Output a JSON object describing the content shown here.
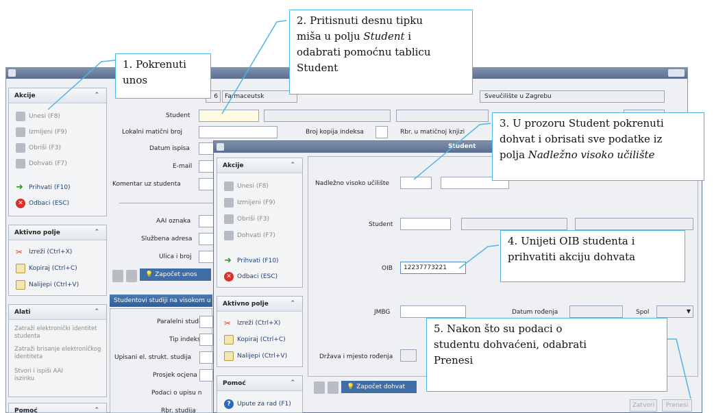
{
  "main_window": {
    "top_row": {
      "num": "6",
      "faculty": "Farmaceutsk",
      "university": "Sveučilište u Zagrebu"
    },
    "labels": {
      "student": "Student",
      "lokalni": "Lokalni matični broj",
      "kopija": "Broj kopija indeksa",
      "rbr": "Rbr. u matičnoj knjizi",
      "datum": "Datum ispisa",
      "email": "E-mail",
      "komentar": "Komentar uz studenta",
      "aai": "AAI oznaka",
      "sluzbena": "Službena adresa",
      "ulica": "Ulica i broj",
      "paralelni": "Paralelni studij",
      "tip": "Tip indeksa",
      "upisani": "Upisani el. strukt. studija",
      "prosjek": "Prosjek ocjena",
      "podaci": "Podaci o upisu n",
      "rbr_studija": "Rbr. studija"
    },
    "start_button": "Započet unos",
    "tab_label": "Studentovi studiji na visokom u"
  },
  "sidebar": {
    "akcije": {
      "title": "Akcije",
      "items": [
        "Unesi (F8)",
        "Izmijeni (F9)",
        "Obriši (F3)",
        "Dohvati (F7)",
        "Prihvati (F10)",
        "Odbaci (ESC)"
      ]
    },
    "aktivno": {
      "title": "Aktivno polje",
      "items": [
        "Izreži (Ctrl+X)",
        "Kopiraj (Ctrl+C)",
        "Nalijepi (Ctrl+V)"
      ]
    },
    "alati": {
      "title": "Alati",
      "items": [
        "Zatraži elektronički identitet studenta",
        "Zatraži brisanje elektroničkog identiteta",
        "Stvori i ispiši AAI iszinku"
      ]
    },
    "pomoc": {
      "title": "Pomoć"
    }
  },
  "dialog": {
    "title": "Student",
    "akcije": {
      "title": "Akcije",
      "items": [
        "Unesi (F8)",
        "Izmijeni (F9)",
        "Obriši (F3)",
        "Dohvati (F7)",
        "Prihvati (F10)",
        "Odbaci (ESC)"
      ]
    },
    "aktivno": {
      "title": "Aktivno polje",
      "items": [
        "Izreži (Ctrl+X)",
        "Kopiraj (Ctrl+C)",
        "Nalijepi (Ctrl+V)"
      ]
    },
    "pomoc": {
      "title": "Pomoć",
      "items": [
        "Upute za rad (F1)"
      ]
    },
    "labels": {
      "nadlezno": "Nadležno visoko učilište",
      "student": "Student",
      "oib": "OIB",
      "jmbg": "JMBG",
      "datum_rodenja": "Datum rođenja",
      "spol": "Spol",
      "drzava": "Država i mjesto rođenja"
    },
    "oib_value": "12237773221",
    "start_button": "Započet dohvat",
    "zatvori": "Zatvori",
    "prenesi": "Prenesi"
  },
  "callouts": {
    "c1": [
      "1. Pokrenuti",
      "unos"
    ],
    "c2": [
      "2. Pritisnuti desnu tipku",
      "miša u polju ",
      "Student",
      " i",
      "odabrati pomoćnu tablicu",
      "Student"
    ],
    "c3": [
      "3. U prozoru Student pokrenuti",
      "dohvat i obrisati sve podatke iz",
      "polja ",
      "Nadležno visoko učilište"
    ],
    "c4": [
      "4. Unijeti OIB studenta i",
      "prihvatiti akciju dohvata"
    ],
    "c5": [
      "5. Nakon što su podaci o",
      "studentu dohvaćeni, odabrati",
      "Prenesi"
    ]
  },
  "colors": {
    "accent": "#4db6e6",
    "titlebar": "#6b7fa0",
    "button": "#3f6ea7"
  }
}
